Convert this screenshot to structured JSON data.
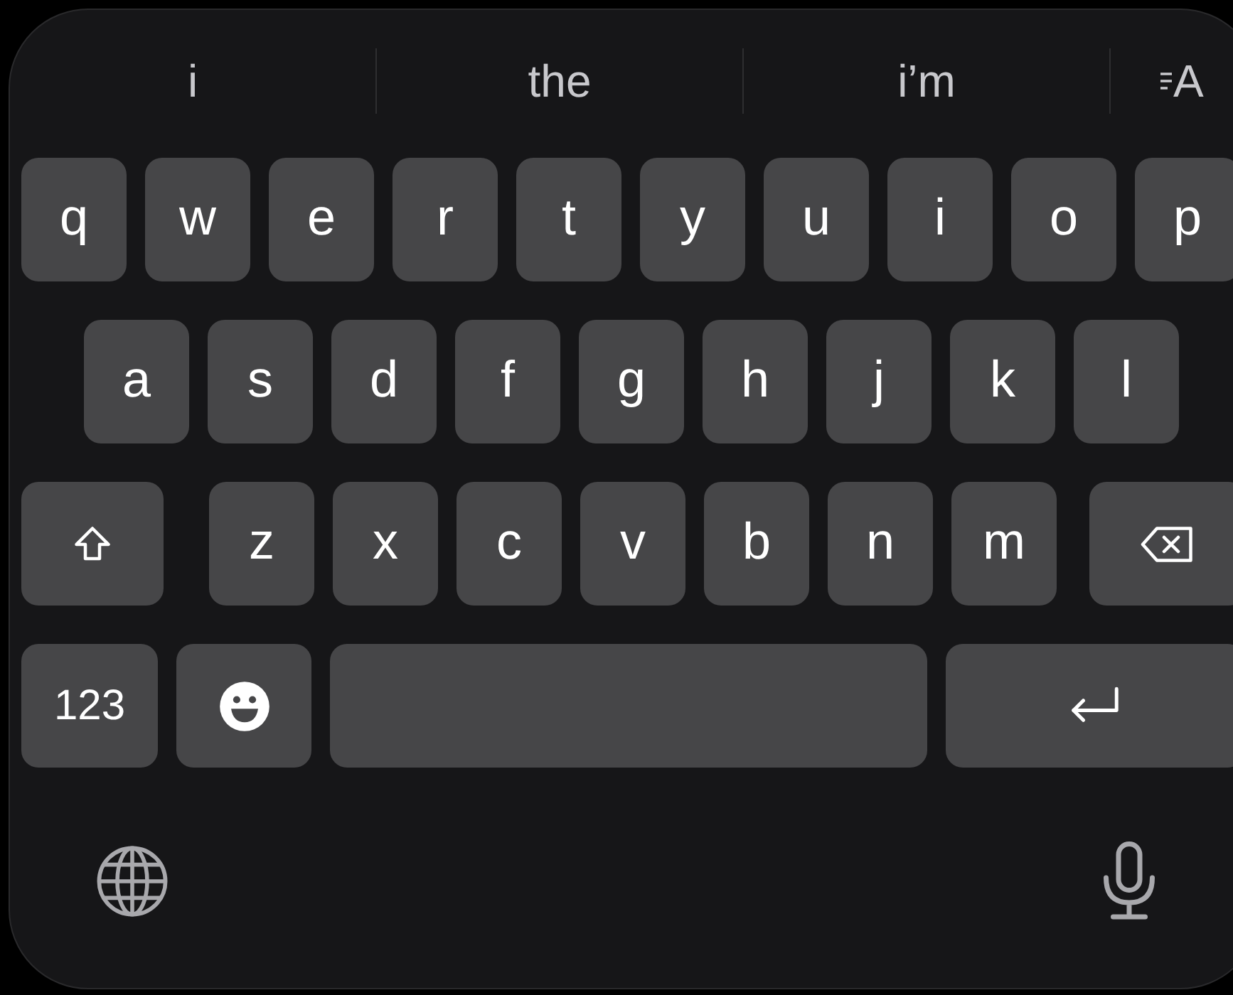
{
  "suggestions": [
    "i",
    "the",
    "i’m"
  ],
  "format_button": {
    "label": "A"
  },
  "rows": [
    [
      {
        "kind": "letter",
        "label": "q"
      },
      {
        "kind": "letter",
        "label": "w"
      },
      {
        "kind": "letter",
        "label": "e"
      },
      {
        "kind": "letter",
        "label": "r"
      },
      {
        "kind": "letter",
        "label": "t"
      },
      {
        "kind": "letter",
        "label": "y"
      },
      {
        "kind": "letter",
        "label": "u"
      },
      {
        "kind": "letter",
        "label": "i"
      },
      {
        "kind": "letter",
        "label": "o"
      },
      {
        "kind": "letter",
        "label": "p"
      }
    ],
    [
      {
        "kind": "letter",
        "label": "a"
      },
      {
        "kind": "letter",
        "label": "s"
      },
      {
        "kind": "letter",
        "label": "d"
      },
      {
        "kind": "letter",
        "label": "f"
      },
      {
        "kind": "letter",
        "label": "g"
      },
      {
        "kind": "letter",
        "label": "h"
      },
      {
        "kind": "letter",
        "label": "j"
      },
      {
        "kind": "letter",
        "label": "k"
      },
      {
        "kind": "letter",
        "label": "l"
      }
    ],
    [
      {
        "kind": "shift"
      },
      {
        "kind": "letter",
        "label": "z"
      },
      {
        "kind": "letter",
        "label": "x"
      },
      {
        "kind": "letter",
        "label": "c"
      },
      {
        "kind": "letter",
        "label": "v"
      },
      {
        "kind": "letter",
        "label": "b"
      },
      {
        "kind": "letter",
        "label": "n"
      },
      {
        "kind": "letter",
        "label": "m"
      },
      {
        "kind": "delete"
      }
    ],
    [
      {
        "kind": "numbers",
        "label": "123"
      },
      {
        "kind": "emoji"
      },
      {
        "kind": "space"
      },
      {
        "kind": "return"
      }
    ]
  ]
}
